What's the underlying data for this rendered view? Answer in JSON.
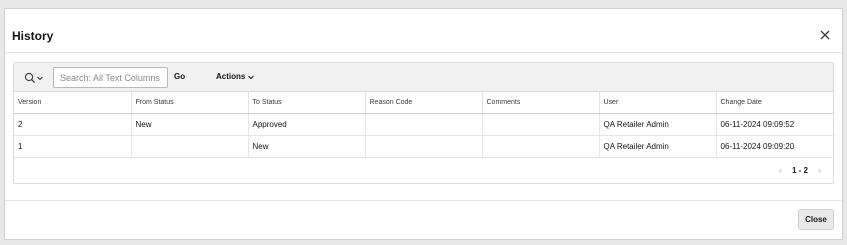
{
  "dialog": {
    "title": "History",
    "close_icon": "close-icon"
  },
  "toolbar": {
    "search_menu_icon": "search-icon",
    "search_placeholder": "Search: All Text Columns",
    "search_value": "",
    "go_label": "Go",
    "actions_label": "Actions"
  },
  "table": {
    "columns": [
      "Version",
      "From Status",
      "To Status",
      "Reason Code",
      "Comments",
      "User",
      "Change Date"
    ],
    "rows": [
      [
        "2",
        "New",
        "Approved",
        "",
        "",
        "QA Retailer Admin",
        "06-11-2024 09:09:52"
      ],
      [
        "1",
        "",
        "New",
        "",
        "",
        "QA Retailer Admin",
        "06-11-2024 09:09:20"
      ]
    ]
  },
  "pagination": {
    "range": "1 - 2",
    "prev_icon": "chevron-left-icon",
    "next_icon": "chevron-right-icon"
  },
  "footer": {
    "close_label": "Close"
  }
}
